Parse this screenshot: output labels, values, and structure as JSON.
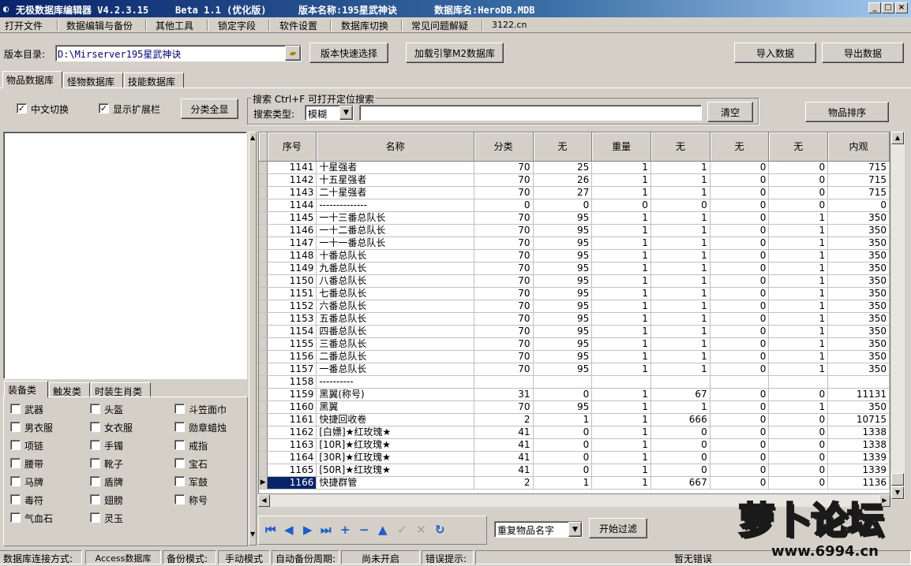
{
  "window": {
    "app_title": "无极数据库编辑器 V4.2.3.15",
    "build": "Beta 1.1 (优化版)",
    "version_name": "版本名称:195星武神诀",
    "db_name": "数据库名:HeroDB.MDB"
  },
  "menu": [
    "打开文件",
    "数据编辑与备份",
    "其他工具",
    "锁定字段",
    "软件设置",
    "数据库切换",
    "常见问题解疑",
    "3122.cn"
  ],
  "toolbar": {
    "dir_label": "版本目录:",
    "dir_value": "D:\\Mirserver195星武神诀",
    "quick_select": "版本快速选择",
    "load_engine": "加载引擎M2数据库",
    "import": "导入数据",
    "export": "导出数据"
  },
  "db_tabs": [
    "物品数据库",
    "怪物数据库",
    "技能数据库"
  ],
  "options": {
    "cn_switch": "中文切换",
    "show_ext": "显示扩展栏",
    "show_all": "分类全显"
  },
  "search": {
    "group_title": "搜索  Ctrl+F 可打开定位搜索",
    "type_label": "搜索类型:",
    "type_value": "模糊",
    "value": "",
    "clear": "清空",
    "sort": "物品排序"
  },
  "cat_tabs": [
    "装备类",
    "触发类",
    "时装生肖类"
  ],
  "categories": [
    "武器",
    "头盔",
    "斗笠面巾",
    "男衣服",
    "女衣服",
    "勋章蜡烛",
    "项链",
    "手镯",
    "戒指",
    "腰带",
    "靴子",
    "宝石",
    "马牌",
    "盾牌",
    "军鼓",
    "毒符",
    "翅膀",
    "称号",
    "气血石",
    "灵玉"
  ],
  "grid": {
    "headers": [
      "序号",
      "名称",
      "分类",
      "无",
      "重量",
      "无",
      "无",
      "无",
      "内观"
    ],
    "rows": [
      [
        "1141",
        "十星强者",
        "70",
        "25",
        "1",
        "1",
        "0",
        "0",
        "715"
      ],
      [
        "1142",
        "十五星强者",
        "70",
        "26",
        "1",
        "1",
        "0",
        "0",
        "715"
      ],
      [
        "1143",
        "二十星强者",
        "70",
        "27",
        "1",
        "1",
        "0",
        "0",
        "715"
      ],
      [
        "1144",
        "--------------",
        "0",
        "0",
        "0",
        "0",
        "0",
        "0",
        "0"
      ],
      [
        "1145",
        "一十三番总队长",
        "70",
        "95",
        "1",
        "1",
        "0",
        "1",
        "350"
      ],
      [
        "1146",
        "一十二番总队长",
        "70",
        "95",
        "1",
        "1",
        "0",
        "1",
        "350"
      ],
      [
        "1147",
        "一十一番总队长",
        "70",
        "95",
        "1",
        "1",
        "0",
        "1",
        "350"
      ],
      [
        "1148",
        "十番总队长",
        "70",
        "95",
        "1",
        "1",
        "0",
        "1",
        "350"
      ],
      [
        "1149",
        "九番总队长",
        "70",
        "95",
        "1",
        "1",
        "0",
        "1",
        "350"
      ],
      [
        "1150",
        "八番总队长",
        "70",
        "95",
        "1",
        "1",
        "0",
        "1",
        "350"
      ],
      [
        "1151",
        "七番总队长",
        "70",
        "95",
        "1",
        "1",
        "0",
        "1",
        "350"
      ],
      [
        "1152",
        "六番总队长",
        "70",
        "95",
        "1",
        "1",
        "0",
        "1",
        "350"
      ],
      [
        "1153",
        "五番总队长",
        "70",
        "95",
        "1",
        "1",
        "0",
        "1",
        "350"
      ],
      [
        "1154",
        "四番总队长",
        "70",
        "95",
        "1",
        "1",
        "0",
        "1",
        "350"
      ],
      [
        "1155",
        "三番总队长",
        "70",
        "95",
        "1",
        "1",
        "0",
        "1",
        "350"
      ],
      [
        "1156",
        "二番总队长",
        "70",
        "95",
        "1",
        "1",
        "0",
        "1",
        "350"
      ],
      [
        "1157",
        "一番总队长",
        "70",
        "95",
        "1",
        "1",
        "0",
        "1",
        "350"
      ],
      [
        "1158",
        "----------",
        "",
        "",
        "",
        "",
        "",
        "",
        ""
      ],
      [
        "1159",
        "黑翼(称号)",
        "31",
        "0",
        "1",
        "67",
        "0",
        "0",
        "11131"
      ],
      [
        "1160",
        "黑翼",
        "70",
        "95",
        "1",
        "1",
        "0",
        "1",
        "350"
      ],
      [
        "1161",
        "快捷回收卷",
        "2",
        "1",
        "1",
        "666",
        "0",
        "0",
        "10715"
      ],
      [
        "1162",
        "[白嫖]★红玫瑰★",
        "41",
        "0",
        "1",
        "0",
        "0",
        "0",
        "1338"
      ],
      [
        "1163",
        "[10R]★红玫瑰★",
        "41",
        "0",
        "1",
        "0",
        "0",
        "0",
        "1338"
      ],
      [
        "1164",
        "[30R]★红玫瑰★",
        "41",
        "0",
        "1",
        "0",
        "0",
        "0",
        "1339"
      ],
      [
        "1165",
        "[50R]★红玫瑰★",
        "41",
        "0",
        "1",
        "0",
        "0",
        "0",
        "1339"
      ],
      [
        "1166",
        "快捷群管",
        "2",
        "1",
        "1",
        "667",
        "0",
        "0",
        "1136"
      ]
    ],
    "selected_row": "1166"
  },
  "filter": {
    "field_value": "重复物品名字",
    "start": "开始过滤"
  },
  "status": {
    "conn_label": "数据库连接方式:",
    "conn_value": "Access数据库",
    "backup_label": "备份模式:",
    "backup_value": "手动模式",
    "auto_label": "自动备份周期:",
    "auto_value": "尚未开启",
    "err_label": "错误提示:",
    "err_value": "暂无错误"
  },
  "watermark": {
    "logo_text": "萝卜论坛",
    "url": "www.6994.cn"
  }
}
